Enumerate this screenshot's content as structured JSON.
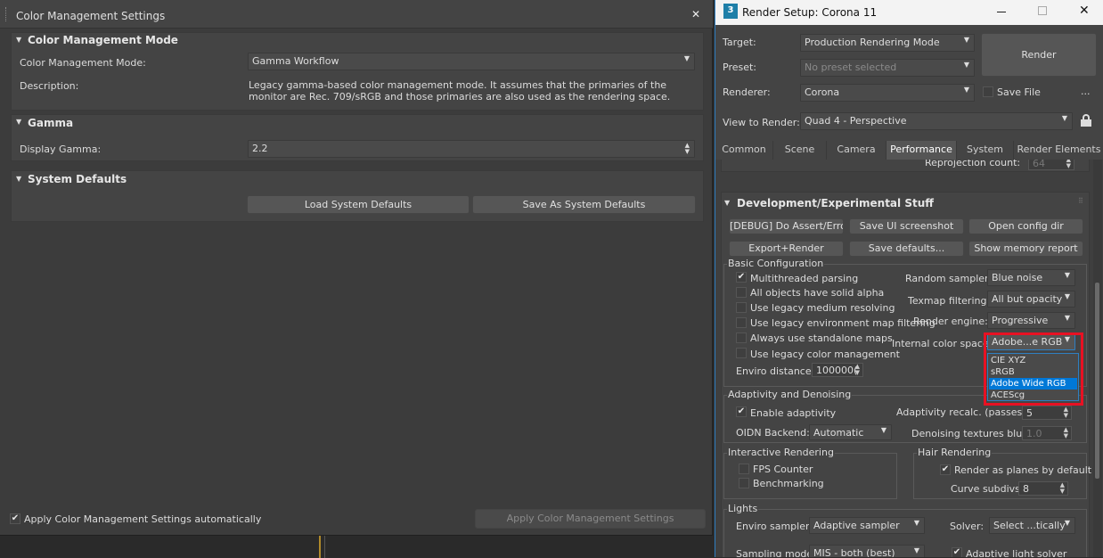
{
  "cm": {
    "title": "Color Management Settings",
    "close": "✕",
    "mode_section": "Color Management Mode",
    "mode_label": "Color Management Mode:",
    "mode_value": "Gamma Workflow",
    "desc_label": "Description:",
    "desc_text": "Legacy gamma-based color management mode. It assumes that the primaries of the monitor are Rec. 709/sRGB and those primaries are also used as the rendering space.",
    "gamma_section": "Gamma",
    "display_gamma_label": "Display Gamma:",
    "display_gamma_value": "2.2",
    "sysdef_section": "System Defaults",
    "load_defaults": "Load System Defaults",
    "save_defaults": "Save As System Defaults",
    "apply_auto_label": "Apply Color Management Settings automatically",
    "apply_button": "Apply Color Management Settings"
  },
  "rs": {
    "app_icon": "3",
    "title": "Render Setup: Corona 11",
    "target_label": "Target:",
    "target_value": "Production Rendering Mode",
    "preset_label": "Preset:",
    "preset_value": "No preset selected",
    "renderer_label": "Renderer:",
    "renderer_value": "Corona",
    "save_file_label": "Save File",
    "more": "...",
    "render_button": "Render",
    "view_label": "View to Render:",
    "view_value": "Quad 4 - Perspective",
    "tabs": [
      "Common",
      "Scene",
      "Camera",
      "Performance",
      "System",
      "Render Elements"
    ],
    "reproj_label": "Reprojection count:",
    "reproj_value": "64",
    "dev_section": "Development/Experimental Stuff",
    "dev_buttons": [
      "[DEBUG] Do Assert/Error",
      "Save UI screenshot",
      "Open config dir",
      "Export+Render",
      "Save defaults...",
      "Show memory report"
    ],
    "basic_cfg": "Basic Configuration",
    "checks": [
      "Multithreaded parsing",
      "All objects have solid alpha",
      "Use legacy medium resolving",
      "Use legacy environment map filtering",
      "Always use standalone maps",
      "Use legacy color management"
    ],
    "random_sampler_label": "Random sampler:",
    "random_sampler_value": "Blue noise",
    "texmap_label": "Texmap filtering:",
    "texmap_value": "All but opacity",
    "engine_label": "Render engine:",
    "engine_value": "Progressive",
    "ics_label": "Internal color space:",
    "ics_value": "Adobe...e RGB",
    "ics_options": [
      "CIE XYZ",
      "sRGB",
      "Adobe Wide RGB",
      "ACEScg"
    ],
    "enviro_dist_label": "Enviro distance:",
    "enviro_dist_value": "100000(",
    "adapt_title": "Adaptivity and Denoising",
    "enable_adapt": "Enable adaptivity",
    "adapt_recalc_label": "Adaptivity recalc. (passes):",
    "adapt_recalc_value": "5",
    "oidn_label": "OIDN Backend:",
    "oidn_value": "Automatic",
    "denoise_blur_label": "Denoising textures blur:",
    "denoise_blur_value": "1.0",
    "interactive_title": "Interactive Rendering",
    "fps_counter": "FPS Counter",
    "benchmarking": "Benchmarking",
    "hair_title": "Hair Rendering",
    "render_planes": "Render as planes by default",
    "curve_subdivs_label": "Curve subdivs:",
    "curve_subdivs_value": "8",
    "lights_title": "Lights",
    "enviro_sampler_label": "Enviro sampler:",
    "enviro_sampler_value": "Adaptive sampler",
    "solver_label": "Solver:",
    "solver_value": "Select ...tically",
    "sampling_mode_label": "Sampling mode:",
    "sampling_mode_value": "MIS - both (best)",
    "adaptive_light_solver": "Adaptive light solver"
  },
  "colors": {
    "highlight": "#0078d7",
    "red_outline": "#e81123",
    "accent_blue": "#2f7fc1"
  }
}
